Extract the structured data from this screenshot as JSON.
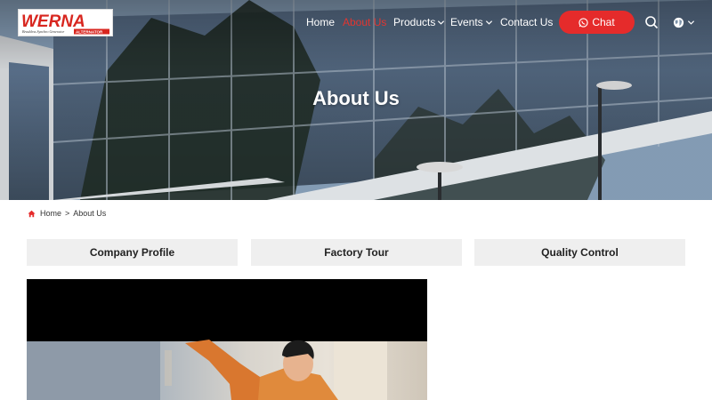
{
  "header": {
    "logo_text": "WERNA",
    "logo_tagline": "Brushless Synchro Generator",
    "logo_badge": "ALTERNATOR",
    "nav": [
      {
        "label": "Home",
        "active": false,
        "has_dropdown": false
      },
      {
        "label": "About Us",
        "active": true,
        "has_dropdown": false
      },
      {
        "label": "Products",
        "active": false,
        "has_dropdown": true
      },
      {
        "label": "Events",
        "active": false,
        "has_dropdown": true
      },
      {
        "label": "Contact Us",
        "active": false,
        "has_dropdown": false
      }
    ],
    "chat_label": "Chat",
    "icons": [
      "whatsapp-icon",
      "search-icon",
      "globe-icon",
      "chevron-down-icon"
    ]
  },
  "hero": {
    "title": "About Us"
  },
  "breadcrumb": {
    "home": "Home",
    "separator": ">",
    "current": "About Us"
  },
  "tabs": [
    {
      "label": "Company Profile"
    },
    {
      "label": "Factory Tour"
    },
    {
      "label": "Quality Control"
    }
  ],
  "colors": {
    "accent": "#e52b2b",
    "active_nav": "#e23530",
    "tab_bg": "#efefef"
  }
}
